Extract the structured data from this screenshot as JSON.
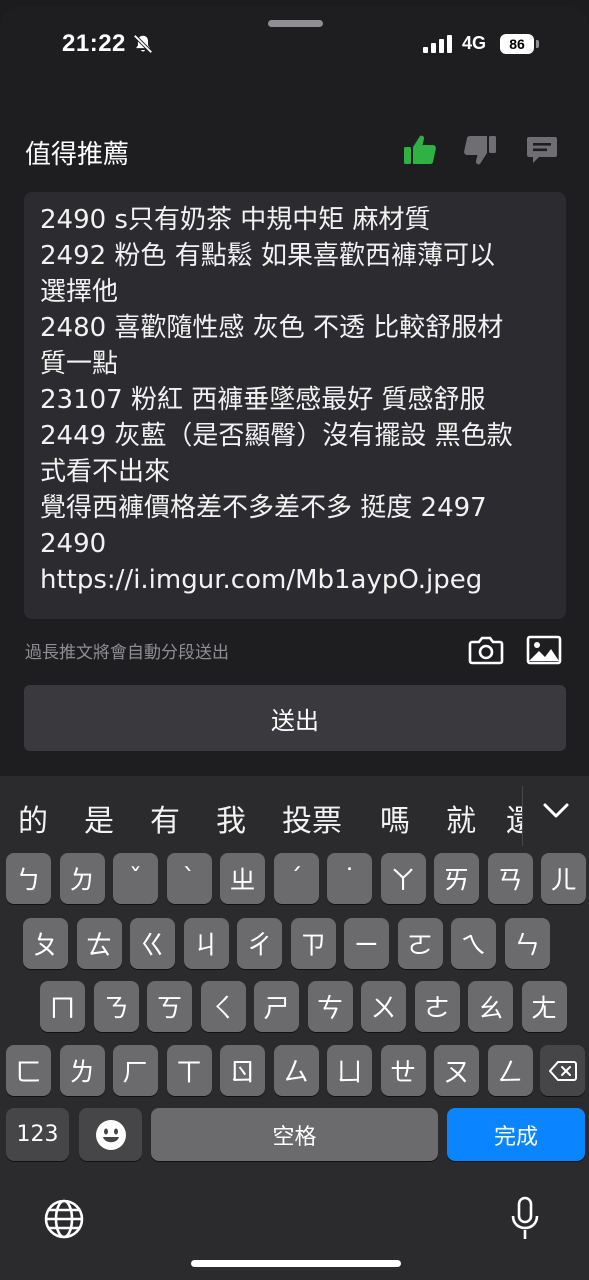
{
  "status": {
    "time": "21:22",
    "network": "4G",
    "battery": "86"
  },
  "header": {
    "title": "值得推薦",
    "accent_green": "#2fb144"
  },
  "composer": {
    "text": "2490 s只有奶茶 中規中矩 麻材質\n2492 粉色 有點鬆 如果喜歡西褲薄可以\n選擇他\n2480 喜歡隨性感 灰色 不透 比較舒服材\n質一點\n23107 粉紅 西褲垂墜感最好 質感舒服\n2449 灰藍（是否顯臀）沒有擺設 黑色款\n式看不出來\n覺得西褲價格差不多差不多 挺度 2497\n2490\nhttps://i.imgur.com/Mb1aypO.jpeg",
    "hint": "過長推文將會自動分段送出",
    "send_label": "送出"
  },
  "keyboard": {
    "candidates": [
      "的",
      "是",
      "有",
      "我",
      "投票",
      "嗎",
      "就",
      "還"
    ],
    "row1": [
      "ㄅ",
      "ㄉ",
      "ˇ",
      "ˋ",
      "ㄓ",
      "ˊ",
      "˙",
      "ㄚ",
      "ㄞ",
      "ㄢ",
      "ㄦ"
    ],
    "row2": [
      "ㄆ",
      "ㄊ",
      "ㄍ",
      "ㄐ",
      "ㄔ",
      "ㄗ",
      "ㄧ",
      "ㄛ",
      "ㄟ",
      "ㄣ"
    ],
    "row3": [
      "ㄇ",
      "ㄋ",
      "ㄎ",
      "ㄑ",
      "ㄕ",
      "ㄘ",
      "ㄨ",
      "ㄜ",
      "ㄠ",
      "ㄤ"
    ],
    "row4": [
      "ㄈ",
      "ㄌ",
      "ㄏ",
      "ㄒ",
      "ㄖ",
      "ㄙ",
      "ㄩ",
      "ㄝ",
      "ㄡ",
      "ㄥ"
    ],
    "numbers_label": "123",
    "space_label": "空格",
    "done_label": "完成"
  }
}
